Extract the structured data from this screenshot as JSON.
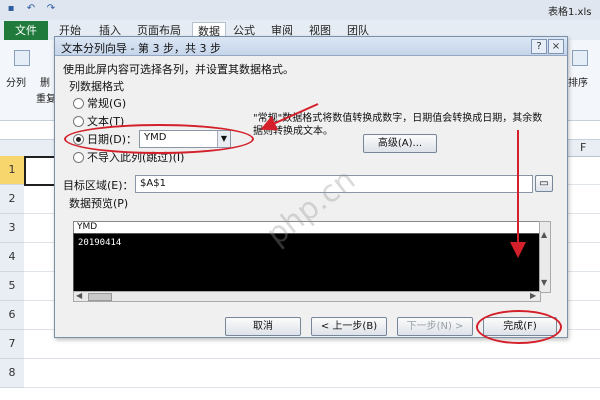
{
  "window": {
    "title": "表格1.xls"
  },
  "quick_access": {
    "icons": [
      "save-icon",
      "undo-icon",
      "redo-icon"
    ],
    "glyphs": [
      "▪",
      "↶",
      "↷"
    ]
  },
  "ribbon": {
    "file_tab": "文件",
    "tabs": [
      "开始",
      "插入",
      "页面布局",
      "数据",
      "公式",
      "审阅",
      "视图",
      "团队"
    ],
    "active_tab": "数据",
    "left_group": [
      "分列",
      "删",
      "重复"
    ],
    "right_group": "排序"
  },
  "sheet": {
    "columns": [
      "F"
    ],
    "rows": [
      "1",
      "2",
      "3",
      "4",
      "5",
      "6",
      "7",
      "8"
    ]
  },
  "dialog": {
    "title": "文本分列向导 - 第 3 步，共 3 步",
    "help_icon": "?",
    "close_icon": "×",
    "description": "使用此屏内容可选择各列，并设置其数据格式。",
    "column_format_label": "列数据格式",
    "options": [
      {
        "label": "常规(G)",
        "selected": false
      },
      {
        "label": "文本(T)",
        "selected": false
      },
      {
        "label": "日期(D)：",
        "selected": true
      },
      {
        "label": "不导入此列(跳过)(I)",
        "selected": false
      }
    ],
    "date_format": "YMD",
    "info_text_line1": "\"常规\"数据格式将数值转换成数字，日期值会转换成日期，其余数",
    "info_text_line2": "据则转换成文本。",
    "advanced_button": "高级(A)...",
    "destination_label": "目标区域(E)：",
    "destination_value": "$A$1",
    "preview_label": "数据预览(P)",
    "preview_header": "YMD",
    "preview_value": "20190414",
    "buttons": {
      "cancel": "取消",
      "back": "< 上一步(B)",
      "next": "下一步(N) >",
      "finish": "完成(F)"
    }
  },
  "watermark": "php.cn",
  "annotation_color": "#d3202a"
}
